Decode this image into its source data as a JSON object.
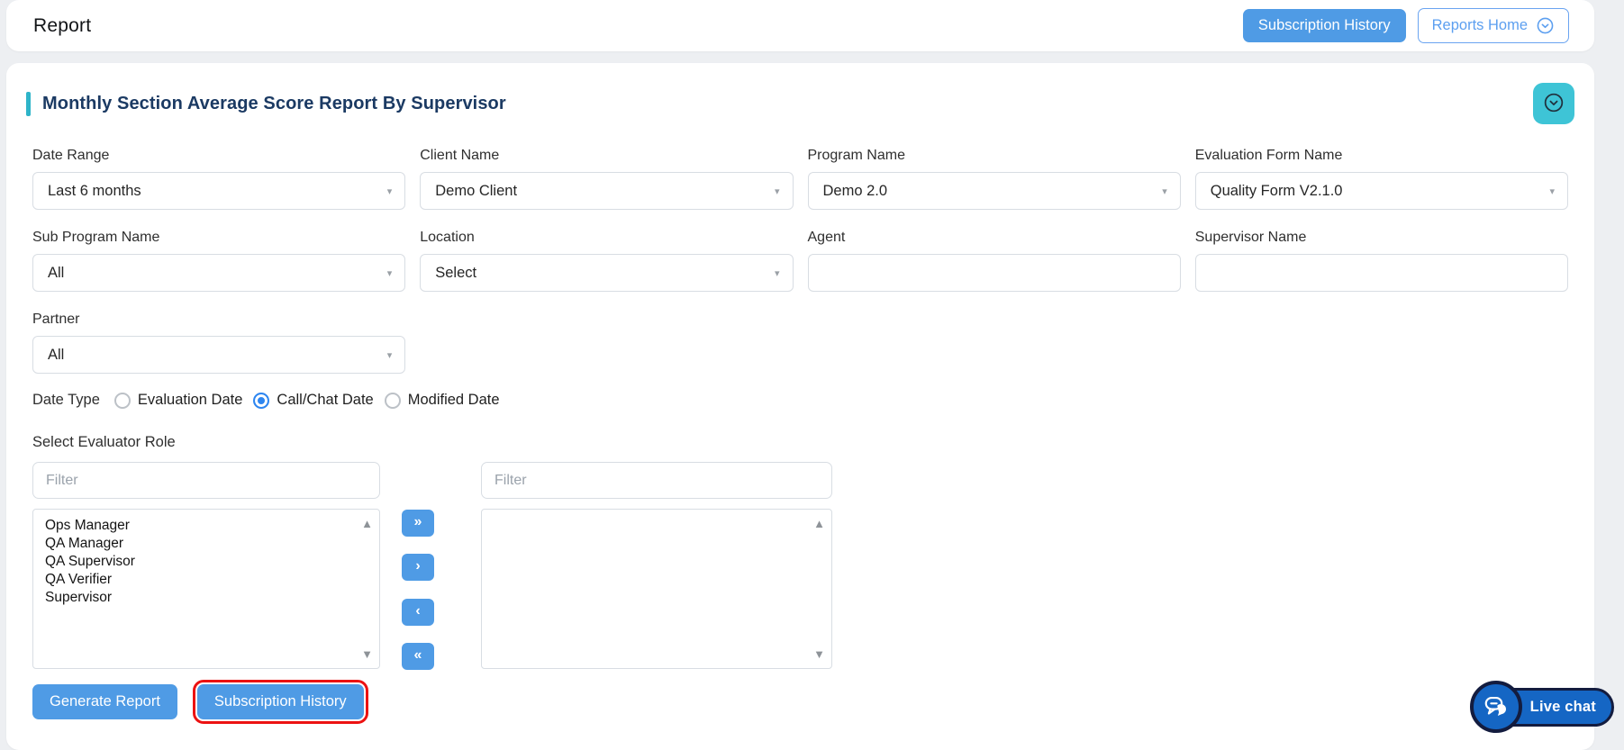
{
  "header": {
    "title": "Report",
    "subscription_history_label": "Subscription History",
    "reports_home_label": "Reports Home"
  },
  "report": {
    "title": "Monthly Section Average Score Report By Supervisor",
    "fields": [
      {
        "label": "Date Range",
        "value": "Last 6 months",
        "type": "select"
      },
      {
        "label": "Client Name",
        "value": "Demo Client",
        "type": "select"
      },
      {
        "label": "Program Name",
        "value": "Demo 2.0",
        "type": "select"
      },
      {
        "label": "Evaluation Form Name",
        "value": "Quality Form V2.1.0",
        "type": "select"
      },
      {
        "label": "Sub Program Name",
        "value": "All",
        "type": "select"
      },
      {
        "label": "Location",
        "value": "Select",
        "type": "select"
      },
      {
        "label": "Agent",
        "value": "",
        "type": "text"
      },
      {
        "label": "Supervisor Name",
        "value": "",
        "type": "text"
      },
      {
        "label": "Partner",
        "value": "All",
        "type": "select"
      }
    ],
    "date_type": {
      "label": "Date Type",
      "options": [
        {
          "label": "Evaluation Date",
          "selected": false
        },
        {
          "label": "Call/Chat Date",
          "selected": true
        },
        {
          "label": "Modified Date",
          "selected": false
        }
      ]
    },
    "evaluator_role": {
      "label": "Select Evaluator Role",
      "filter_placeholder": "Filter",
      "available": [
        "Ops Manager",
        "QA Manager",
        "QA Supervisor",
        "QA Verifier",
        "Supervisor"
      ],
      "selected": [],
      "transfer_buttons": [
        "»",
        "›",
        "‹",
        "«"
      ]
    },
    "actions": {
      "generate_report_label": "Generate Report",
      "subscription_history_label": "Subscription History"
    }
  },
  "chat": {
    "label": "Live chat"
  },
  "icons": {
    "select_caret": "▾",
    "scroll_up": "▲",
    "scroll_down": "▼"
  },
  "colors": {
    "primary_blue": "#4f9be5",
    "outline_blue": "#5c9ff0",
    "accent_teal": "#3ec4d6",
    "title_navy": "#1b3a63",
    "radio_blue": "#2e86f0",
    "highlight_red": "#ec1212",
    "chat_blue": "#1566c4",
    "chat_ring_navy": "#131c3f"
  }
}
